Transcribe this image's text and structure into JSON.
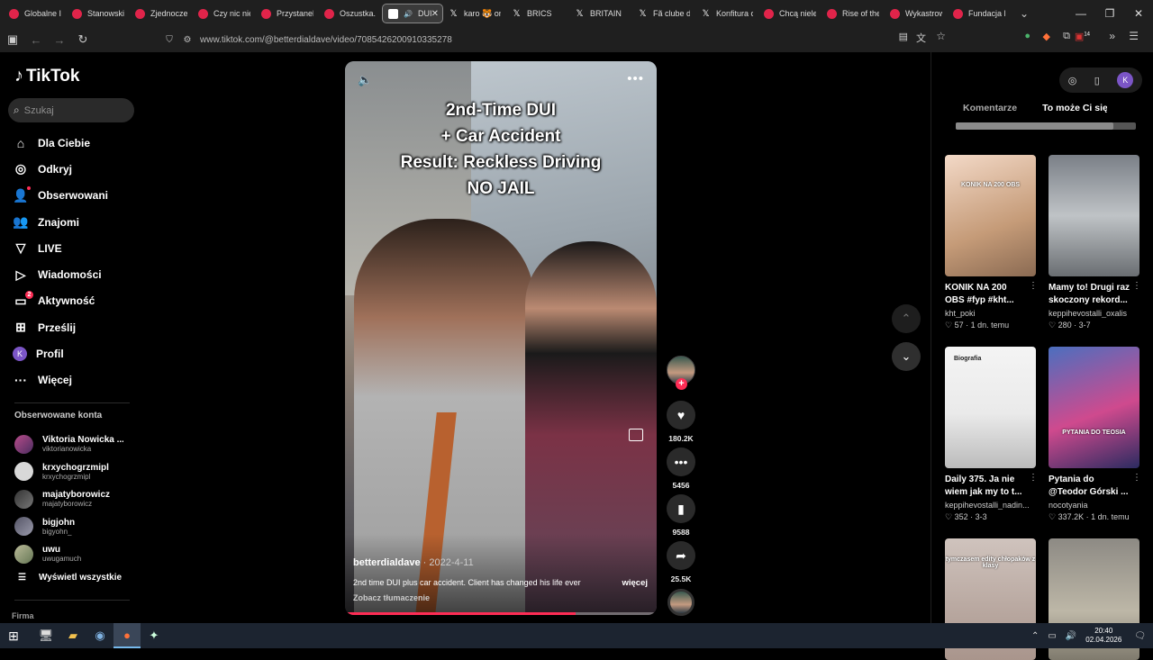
{
  "browser": {
    "tabs": [
      {
        "label": "Globalne Im",
        "icon": "youtube-icon"
      },
      {
        "label": "Stanowski w",
        "icon": "youtube-icon"
      },
      {
        "label": "Zjednoczen",
        "icon": "youtube-icon"
      },
      {
        "label": "Czy nic nie",
        "icon": "youtube-icon"
      },
      {
        "label": "Przystanek",
        "icon": "youtube-icon"
      },
      {
        "label": "Oszustka. W",
        "icon": "youtube-icon"
      },
      {
        "label": "DUI",
        "icon": "tiktok-icon",
        "active": true
      },
      {
        "label": "karo 🐯 on",
        "icon": "x-icon"
      },
      {
        "label": "BRICS",
        "icon": "x-icon"
      },
      {
        "label": "BRITAIN",
        "icon": "x-icon"
      },
      {
        "label": "Fã clube do",
        "icon": "x-icon"
      },
      {
        "label": "Konfitura or",
        "icon": "x-icon"
      },
      {
        "label": "Chcą nieleg",
        "icon": "youtube-icon"
      },
      {
        "label": "Rise of the",
        "icon": "youtube-icon"
      },
      {
        "label": "Wykastrowa",
        "icon": "youtube-icon"
      },
      {
        "label": "Fundacja EC",
        "icon": "youtube-icon"
      }
    ],
    "url": "www.tiktok.com/@betterdialdave/video/7085426200910335278",
    "notification_count": "14"
  },
  "sidebar": {
    "logo_text": "TikTok",
    "search_placeholder": "Szukaj",
    "nav": [
      {
        "label": "Dla Ciebie",
        "icon": "home-icon"
      },
      {
        "label": "Odkryj",
        "icon": "compass-icon"
      },
      {
        "label": "Obserwowani",
        "icon": "user-follow-icon"
      },
      {
        "label": "Znajomi",
        "icon": "friends-icon"
      },
      {
        "label": "LIVE",
        "icon": "live-icon"
      },
      {
        "label": "Wiadomości",
        "icon": "send-icon"
      },
      {
        "label": "Aktywność",
        "icon": "inbox-icon",
        "badge": "2"
      },
      {
        "label": "Prześlij",
        "icon": "upload-icon"
      },
      {
        "label": "Profil",
        "icon": "profile-avatar",
        "avatar_letter": "K"
      },
      {
        "label": "Więcej",
        "icon": "more-icon"
      }
    ],
    "following_title": "Obserwowane konta",
    "following": [
      {
        "name": "Viktoria Nowicka ...",
        "username": "viktorianowicka"
      },
      {
        "name": "krxychogrzmipl",
        "username": "krxychogrzmipl"
      },
      {
        "name": "majatyborowicz",
        "username": "majatyborowicz"
      },
      {
        "name": "bigjohn",
        "username": "bigyohn_"
      },
      {
        "name": "uwu",
        "username": "uwugamuch"
      }
    ],
    "show_all": "Wyświetl wszystkie",
    "company": "Firma"
  },
  "video": {
    "overlay_lines": [
      "2nd-Time DUI",
      "+ Car Accident",
      "Result: Reckless Driving",
      "NO JAIL"
    ],
    "author": "betterdialdave",
    "date": "2022-4-11",
    "caption": "2nd time DUI plus car accident. Client has changed his life ever",
    "more": "więcej",
    "translate": "Zobacz tłumaczenie",
    "progress": 0.74
  },
  "actions": {
    "likes": "180.2K",
    "comments": "5456",
    "saves": "9588",
    "shares": "25.5K"
  },
  "right_panel": {
    "avatar_letter": "K",
    "tabs": [
      "Komentarze",
      "To może Ci się spodoba"
    ],
    "cards": [
      {
        "title": "KONIK NA 200 OBS #fyp #kht...",
        "user": "kht_poki",
        "likes": "57",
        "time": "1 dn. temu",
        "overlay": "KONIK NA 200 OBS"
      },
      {
        "title": "Mamy to! Drugi raz skoczony rekord...",
        "user": "keppihevostalli_oxalis",
        "likes": "280",
        "time": "3-7",
        "overlay": ""
      },
      {
        "title": "Daily 375. Ja nie wiem jak my to t...",
        "user": "keppihevostalli_nadin...",
        "likes": "352",
        "time": "3-3",
        "overlay": "Biografia"
      },
      {
        "title": "Pytania do @Teodor Górski ...",
        "user": "nocotyania",
        "likes": "337.2K",
        "time": "1 dn. temu",
        "overlay": "PYTANIA DO TEOSIA"
      },
      {
        "title": "",
        "user": "",
        "likes": "",
        "time": "",
        "overlay": "tymczasem edity chłopaków z klasy"
      },
      {
        "title": "",
        "user": "",
        "likes": "",
        "time": "",
        "overlay": ""
      }
    ]
  },
  "taskbar": {
    "time": "20:40",
    "date": "02.04.2026"
  }
}
